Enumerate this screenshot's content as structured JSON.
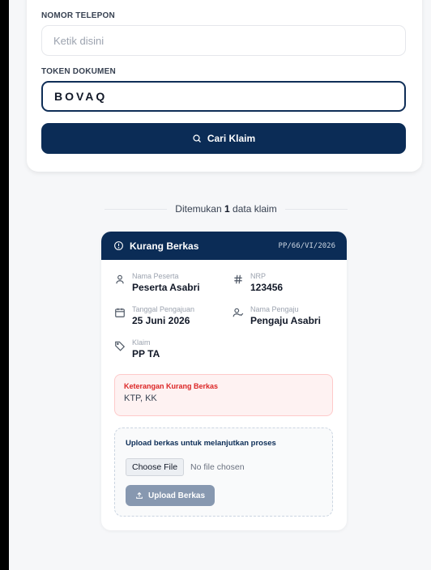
{
  "form": {
    "phone_label": "NOMOR TELEPON",
    "phone_placeholder": "Ketik disini",
    "token_label": "TOKEN DOKUMEN",
    "token_value": "BOVAQ",
    "search_button": "Cari Klaim"
  },
  "results": {
    "prefix": "Ditemukan",
    "count": "1",
    "suffix": "data klaim"
  },
  "claim": {
    "status": "Kurang Berkas",
    "code": "PP/66/VI/2026",
    "fields": {
      "peserta_label": "Nama Peserta",
      "peserta_value": "Peserta Asabri",
      "nrp_label": "NRP",
      "nrp_value": "123456",
      "tanggal_label": "Tanggal Pengajuan",
      "tanggal_value": "25 Juni 2026",
      "pengaju_label": "Nama Pengaju",
      "pengaju_value": "Pengaju Asabri",
      "klaim_label": "Klaim",
      "klaim_value": "PP TA"
    },
    "note_title": "Keterangan Kurang Berkas",
    "note_value": "KTP, KK",
    "upload": {
      "title": "Upload berkas untuk melanjutkan proses",
      "choose_label": "Choose File",
      "no_file": "No file chosen",
      "button": "Upload Berkas"
    }
  },
  "colors": {
    "primary": "#0b2c56",
    "danger": "#dc2626",
    "upload_button": "#8798b0"
  },
  "icons": [
    "search-icon",
    "alert-circle-icon",
    "user-icon",
    "hash-icon",
    "calendar-icon",
    "user-check-icon",
    "tag-icon",
    "upload-icon"
  ]
}
